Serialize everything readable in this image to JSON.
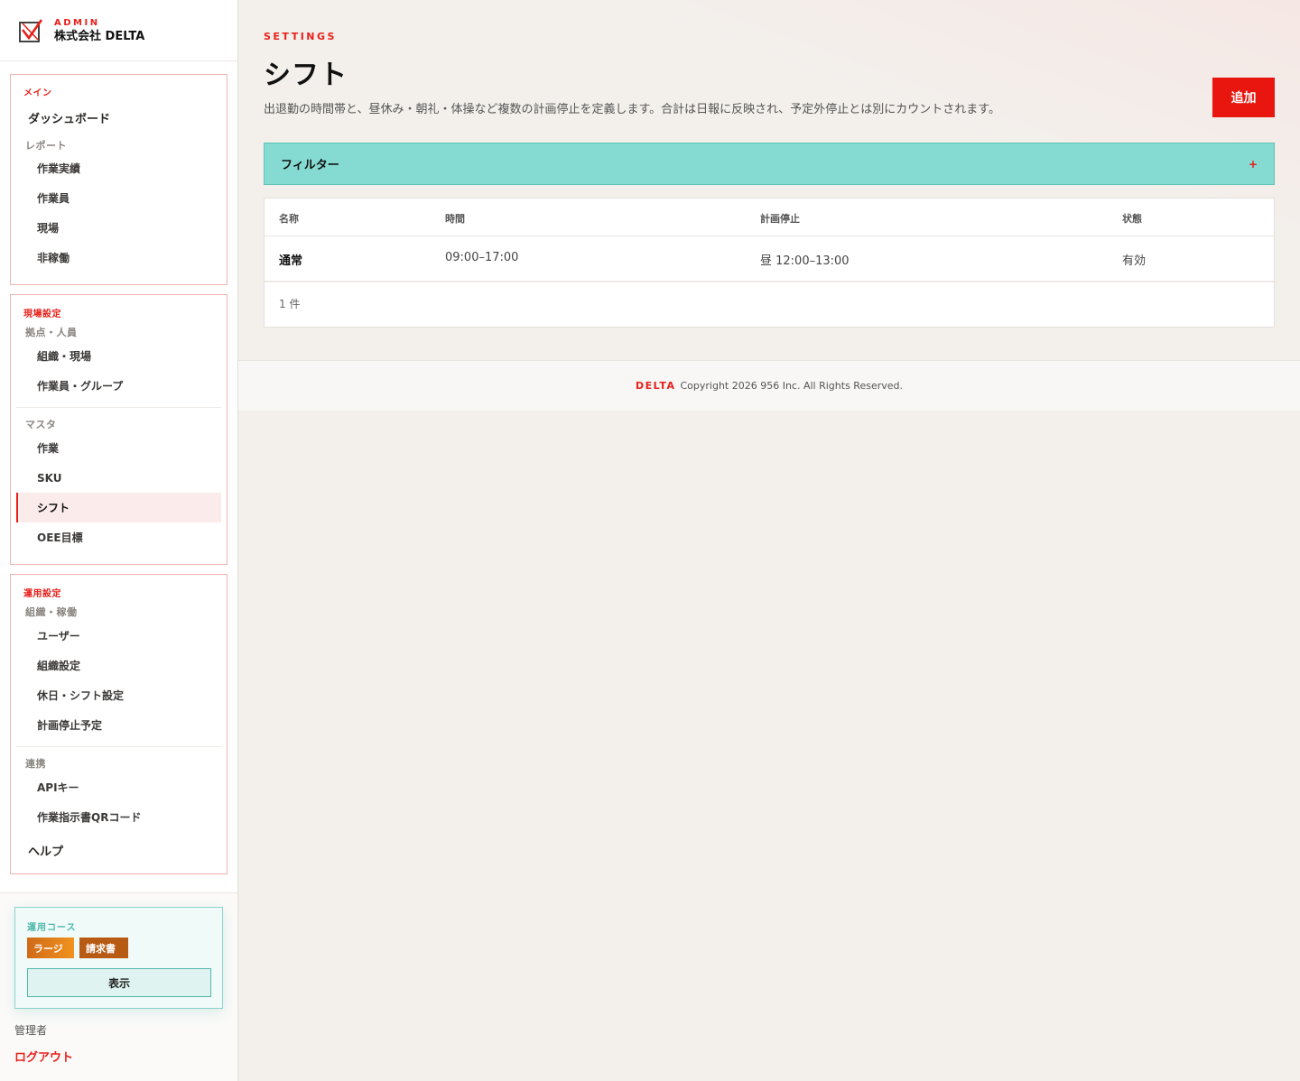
{
  "brand": {
    "admin_label": "ADMIN",
    "company": "株式会社 DELTA",
    "logo_icon": "checkbox-logo-icon",
    "accent_color": "#e8201a"
  },
  "sidebar": {
    "main": {
      "title": "メイン",
      "dashboard": "ダッシュボード",
      "reports_label": "レポート",
      "reports": [
        "作業実績",
        "作業員",
        "現場",
        "非稼働"
      ]
    },
    "site_settings": {
      "title": "現場設定",
      "base_label": "拠点・人員",
      "base_items": [
        "組織・現場",
        "作業員・グループ"
      ],
      "master_label": "マスタ",
      "master_items": [
        "作業",
        "SKU",
        "シフト",
        "OEE目標"
      ],
      "active_item": "シフト"
    },
    "ops_settings": {
      "title": "運用設定",
      "org_label": "組織・稼働",
      "org_items": [
        "ユーザー",
        "組織設定",
        "休日・シフト設定",
        "計画停止予定"
      ],
      "link_label": "連携",
      "link_items": [
        "APIキー",
        "作業指示書QRコード"
      ],
      "help": "ヘルプ"
    },
    "plan": {
      "title": "運用コース",
      "badge_large": "ラージ",
      "badge_invoice": "請求書",
      "show_button": "表示",
      "teal_color": "#4fb8ab"
    },
    "user_role": "管理者",
    "logout": "ログアウト"
  },
  "main": {
    "eyebrow": "SETTINGS",
    "title": "シフト",
    "description": "出退勤の時間帯と、昼休み・朝礼・体操など複数の計画停止を定義します。合計は日報に反映され、予定外停止とは別にカウントされます。",
    "add_button": "追加",
    "filter": {
      "label": "フィルター",
      "toggle": "+"
    },
    "table": {
      "headers": [
        "名称",
        "時間",
        "計画停止",
        "状態"
      ],
      "rows": [
        {
          "name": "通常",
          "time": "09:00–17:00",
          "planned_stop": "昼 12:00–13:00",
          "status": "有効"
        }
      ],
      "count": "1 件"
    },
    "footer": {
      "brand": "DELTA",
      "copyright": "Copyright 2026 956 Inc. All Rights Reserved."
    }
  }
}
